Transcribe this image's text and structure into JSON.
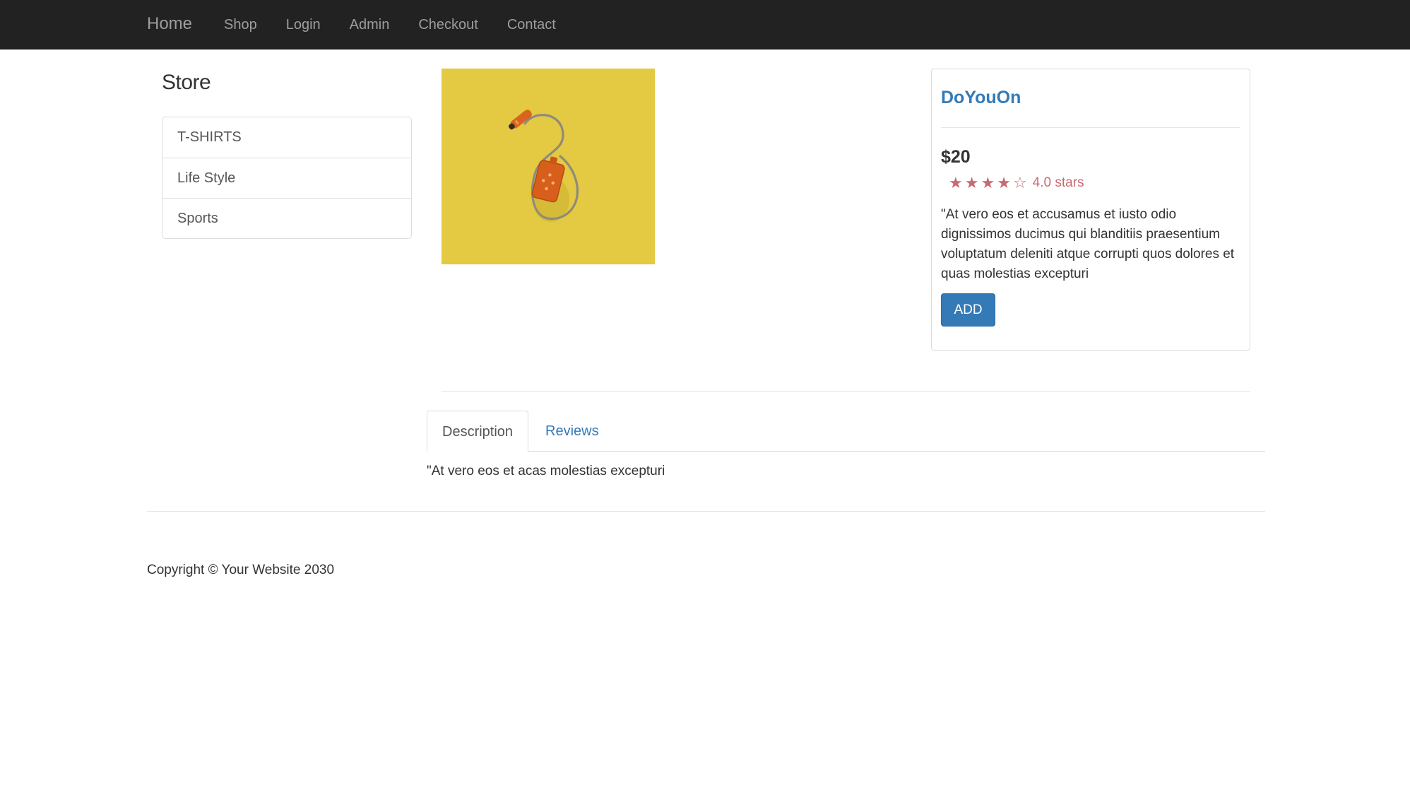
{
  "nav": {
    "brand": "Home",
    "links": [
      "Shop",
      "Login",
      "Admin",
      "Checkout",
      "Contact"
    ]
  },
  "sidebar": {
    "title": "Store",
    "categories": [
      "T-SHIRTS",
      "Life Style",
      "Sports"
    ]
  },
  "product": {
    "image_icon": "headphones-mp3-player-icon",
    "name": "DoYouOn",
    "price": "$20",
    "rating_value": 4,
    "rating_max": 5,
    "rating_text": "4.0 stars",
    "description": "\"At vero eos et accusamus et iusto odio dignissimos ducimus qui blanditiis praesentium voluptatum deleniti atque corrupti quos dolores et quas molestias excepturi",
    "add_label": "ADD"
  },
  "tabs": {
    "items": [
      "Description",
      "Reviews"
    ],
    "active": "Description",
    "content": "\"At vero eos et acas molestias excepturi"
  },
  "footer": {
    "copyright": "Copyright © Your Website 2030"
  },
  "colors": {
    "navbar": "#222222",
    "link": "#337ab7",
    "button": "#337ab7",
    "star": "#c86a72",
    "image_bg": "#e4c942"
  }
}
